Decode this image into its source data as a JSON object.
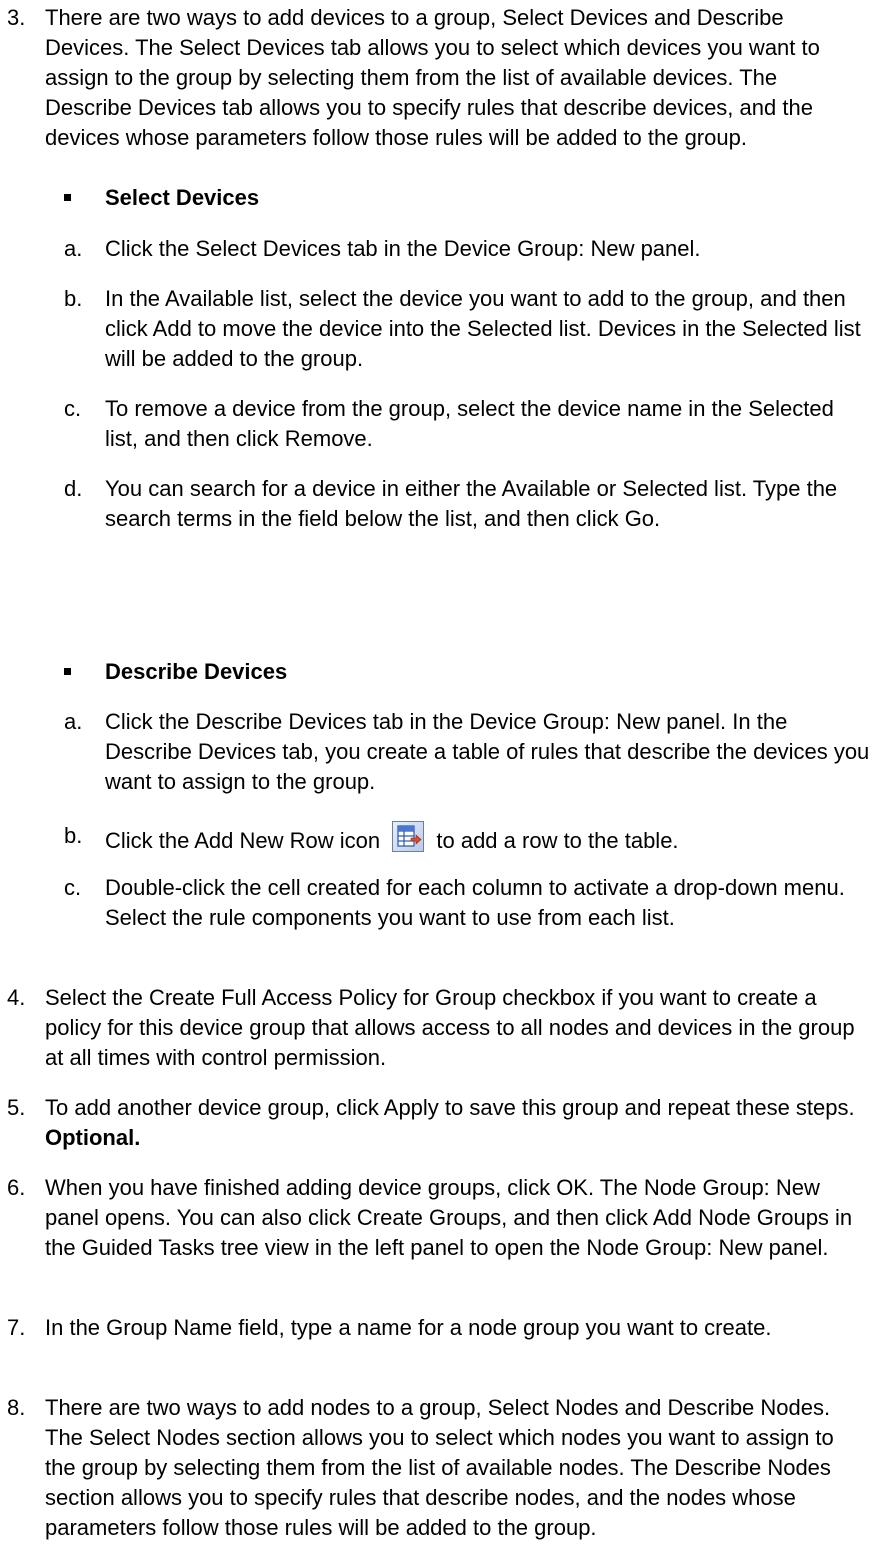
{
  "steps": {
    "s3": {
      "num": "3.",
      "text": "There are two ways to add devices to a group, Select Devices and Describe Devices. The Select Devices tab allows you to select which devices you want to assign to the group by selecting them from the list of available devices. The Describe Devices tab allows you to specify rules that describe devices, and the devices whose parameters follow those rules will be added to the group."
    },
    "select_heading": "Select Devices",
    "select": [
      {
        "letter": "a.",
        "text": "Click the Select Devices tab in the Device Group: New panel."
      },
      {
        "letter": "b.",
        "text": "In the Available list, select the device you want to add to the group, and then click Add to move the device into the Selected list. Devices in the Selected list will be added to the group."
      },
      {
        "letter": "c.",
        "text": "To remove a device from the group, select the device name in the Selected list, and then click Remove."
      },
      {
        "letter": "d.",
        "text": "You can search for a device in either the Available or Selected list. Type the search terms in the field below the list, and then click Go."
      }
    ],
    "describe_heading": "Describe Devices",
    "describe": [
      {
        "letter": "a.",
        "text": "Click the Describe Devices tab in the Device Group: New panel. In the Describe Devices tab, you create a table of rules that describe the devices you want to assign to the group."
      },
      {
        "letter": "b.",
        "text_before": "Click the Add New Row icon",
        "text_after": "to add a row to the table.",
        "icon": "add-new-row-icon"
      },
      {
        "letter": "c.",
        "text": "Double-click the cell created for each column to activate a drop-down menu. Select the rule components you want to use from each list."
      }
    ],
    "s4": {
      "num": "4.",
      "text": "Select the Create Full Access Policy for Group checkbox if you want to create a policy for this device group that allows access to all nodes and devices in the group at all times with control permission."
    },
    "s5": {
      "num": "5.",
      "text": "To add another device group, click Apply to save this group and repeat these steps.",
      "bold": "Optional."
    },
    "s6": {
      "num": "6.",
      "text": "When you have finished adding device groups, click OK. The Node Group: New panel opens. You can also click Create Groups, and then click Add Node Groups in the Guided Tasks tree view in the left panel to open the Node Group: New panel."
    },
    "s7": {
      "num": "7.",
      "text": "In the Group Name field, type a name for a node group you want to create."
    },
    "s8": {
      "num": "8.",
      "text": "There are two ways to add nodes to a group, Select Nodes and Describe Nodes. The Select Nodes section allows you to select which nodes you want to assign to the group by selecting them from the list of available nodes. The Describe Nodes section allows you to specify rules that describe nodes, and the nodes whose parameters follow those rules will be added to the group."
    }
  }
}
